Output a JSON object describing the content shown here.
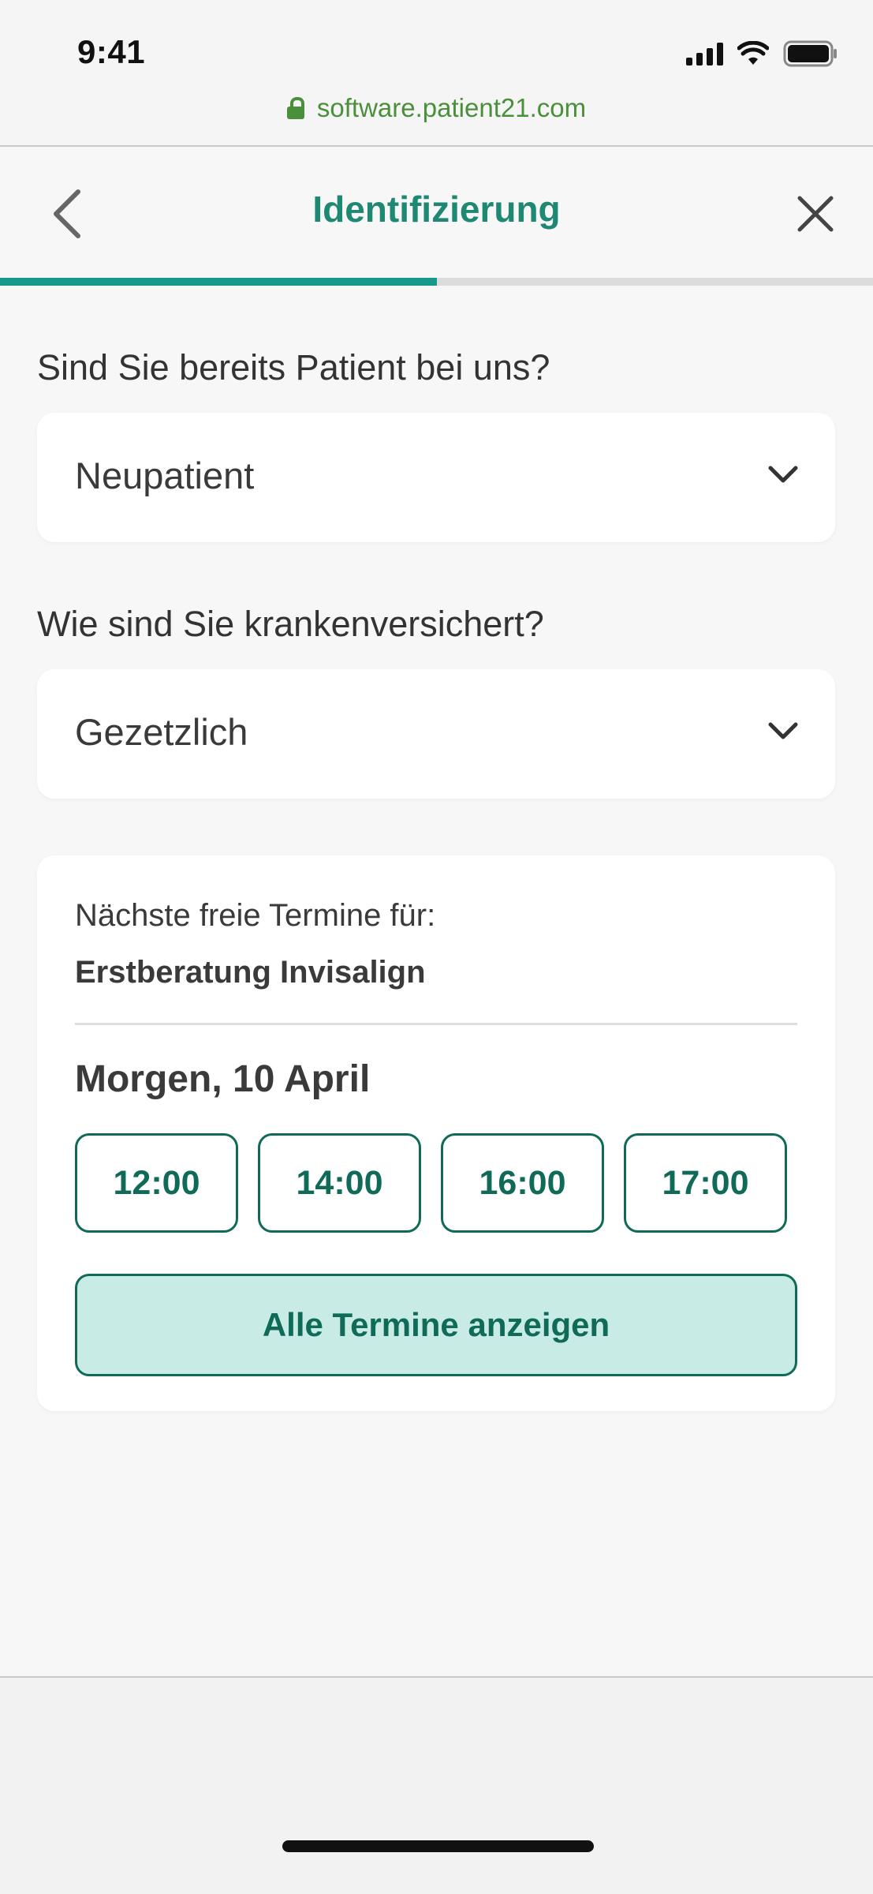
{
  "status_bar": {
    "time": "9:41",
    "url": "software.patient21.com"
  },
  "header": {
    "title": "Identifizierung",
    "progress_fraction": 0.5
  },
  "form": {
    "patient_question": "Sind Sie bereits Patient bei uns?",
    "patient_value": "Neupatient",
    "insurance_question": "Wie sind Sie krankenversichert?",
    "insurance_value": "Gezetzlich"
  },
  "appointments": {
    "label": "Nächste freie Termine für:",
    "treatment": "Erstberatung Invisalign",
    "date": "Morgen, 10 April",
    "slots": [
      "12:00",
      "14:00",
      "16:00",
      "17:00"
    ],
    "all_button_label": "Alle Termine anzeigen"
  },
  "colors": {
    "accent": "#1e8872",
    "button_border": "#0f6b58",
    "button_fill": "#c8ece5",
    "progress": "#15998a",
    "url": "#4a8f3a"
  },
  "icons": {
    "back": "chevron-left-icon",
    "close": "close-icon",
    "select": "chevron-down-icon",
    "lock": "lock-icon"
  }
}
